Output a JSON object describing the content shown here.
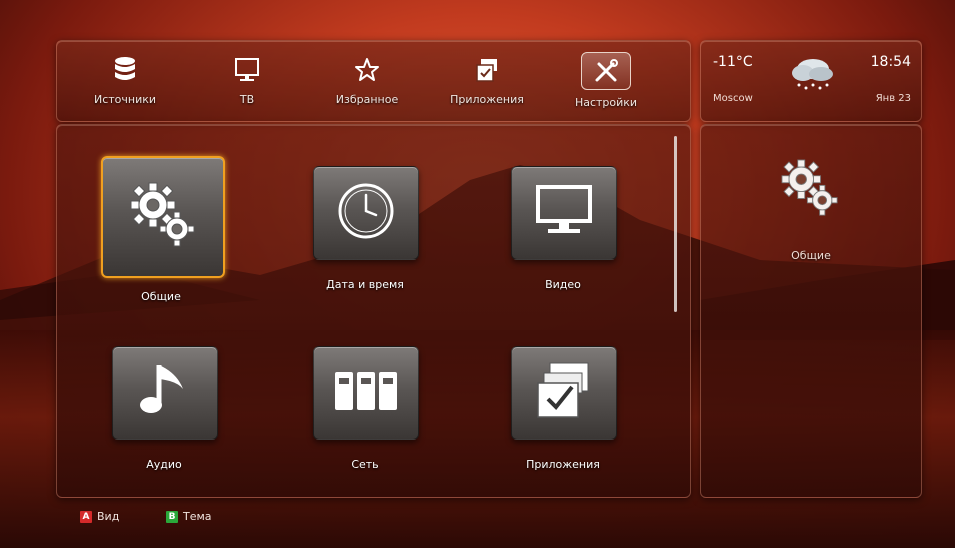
{
  "nav": {
    "items": [
      {
        "label": "Источники",
        "icon": "database-icon"
      },
      {
        "label": "ТВ",
        "icon": "tv-icon"
      },
      {
        "label": "Избранное",
        "icon": "star-icon"
      },
      {
        "label": "Приложения",
        "icon": "apps-icon"
      },
      {
        "label": "Настройки",
        "icon": "tools-icon",
        "active": true
      }
    ]
  },
  "weather": {
    "temperature": "-11°C",
    "city": "Moscow",
    "time": "18:54",
    "date": "Янв 23",
    "icon": "snow-cloud-icon"
  },
  "settings": {
    "tiles": [
      {
        "label": "Общие",
        "icon": "gears-icon",
        "selected": true
      },
      {
        "label": "Дата и время",
        "icon": "clock-icon"
      },
      {
        "label": "Видео",
        "icon": "monitor-icon"
      },
      {
        "label": "Аудио",
        "icon": "music-note-icon"
      },
      {
        "label": "Сеть",
        "icon": "network-icon"
      },
      {
        "label": "Приложения",
        "icon": "apps-check-icon"
      }
    ]
  },
  "preview": {
    "label": "Общие",
    "icon": "gears-icon"
  },
  "hints": {
    "a_key": "A",
    "a_label": "Вид",
    "a_color": "#d42a2a",
    "b_key": "B",
    "b_label": "Тема",
    "b_color": "#2aa83a"
  },
  "colors": {
    "selection": "#f0a020"
  }
}
